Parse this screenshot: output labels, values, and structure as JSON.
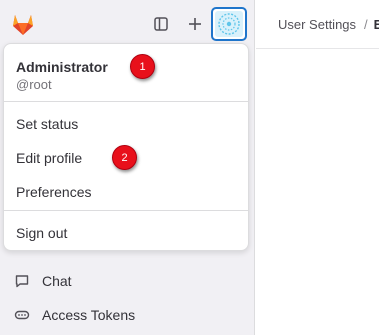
{
  "breadcrumb": {
    "parent": "User Settings",
    "separator": "/",
    "current": "E"
  },
  "sidebar": {
    "items": [
      {
        "label": "Chat",
        "icon": "chat-icon"
      },
      {
        "label": "Access Tokens",
        "icon": "token-icon"
      }
    ]
  },
  "user_menu": {
    "name": "Administrator",
    "username": "@root",
    "items": [
      {
        "label": "Set status"
      },
      {
        "label": "Edit profile"
      },
      {
        "label": "Preferences"
      }
    ],
    "sign_out": "Sign out"
  },
  "annotations": [
    {
      "label": "1"
    },
    {
      "label": "2"
    }
  ],
  "colors": {
    "accent": "#1f75cb",
    "marker": "#e8101b",
    "sidebar_bg": "#f1f0f4",
    "logo": "#e24329"
  },
  "icons": [
    "gitlab-logo-icon",
    "sidebar-toggle-icon",
    "plus-icon",
    "avatar-icon",
    "chat-icon",
    "token-icon"
  ]
}
